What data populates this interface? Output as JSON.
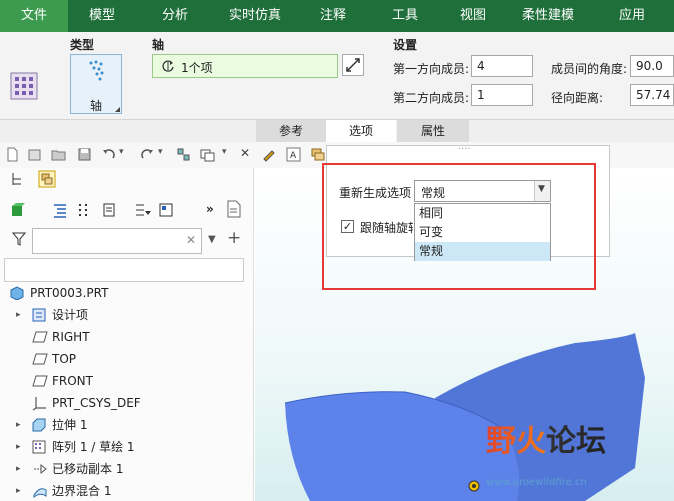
{
  "menubar": {
    "items": [
      "文件",
      "模型",
      "分析",
      "实时仿真",
      "注释",
      "工具",
      "视图",
      "柔性建模",
      "应用"
    ],
    "active_index": 0
  },
  "ribbon": {
    "type_label": "类型",
    "type_button": "轴",
    "axis_label": "轴",
    "axis_value": "1个项",
    "settings_label": "设置",
    "first_dir_label": "第一方向成员:",
    "first_dir_value": "4",
    "second_dir_label": "第二方向成员:",
    "second_dir_value": "1",
    "angle_label": "成员间的角度:",
    "angle_value": "90.0",
    "radial_label": "径向距离:",
    "radial_value": "57.74"
  },
  "ribbon_tabs": {
    "items": [
      "参考",
      "选项",
      "属性"
    ],
    "active_index": 1
  },
  "options_popup": {
    "handle": "····",
    "regen_label": "重新生成选项",
    "regen_value": "常规",
    "options": [
      "相同",
      "可变",
      "常规"
    ],
    "selected_index": 2,
    "follow_checkbox_label": "跟随轴旋转",
    "follow_checked": true
  },
  "model_tree": {
    "root": "PRT0003.PRT",
    "items": [
      {
        "label": "设计项",
        "icon": "design-items-icon",
        "expandable": true
      },
      {
        "label": "RIGHT",
        "icon": "datum-plane-icon",
        "expandable": false
      },
      {
        "label": "TOP",
        "icon": "datum-plane-icon",
        "expandable": false
      },
      {
        "label": "FRONT",
        "icon": "datum-plane-icon",
        "expandable": false
      },
      {
        "label": "PRT_CSYS_DEF",
        "icon": "csys-icon",
        "expandable": false
      },
      {
        "label": "拉伸 1",
        "icon": "extrude-icon",
        "expandable": true
      },
      {
        "label": "阵列 1 / 草绘 1",
        "icon": "pattern-icon",
        "expandable": true
      },
      {
        "label": "已移动副本 1",
        "icon": "moved-copy-icon",
        "expandable": true
      },
      {
        "label": "边界混合 1",
        "icon": "boundary-blend-icon",
        "expandable": true
      }
    ]
  },
  "watermark": {
    "text": "野火论坛",
    "url": "www.proewildfire.cn"
  },
  "colors": {
    "menubar_bg": "#1f6f3a",
    "menu_active_bg": "#3c9b4f",
    "model_surface": "#5b7fe6",
    "highlight_box": "#e53935",
    "selected_option_bg": "#cce8f6"
  }
}
